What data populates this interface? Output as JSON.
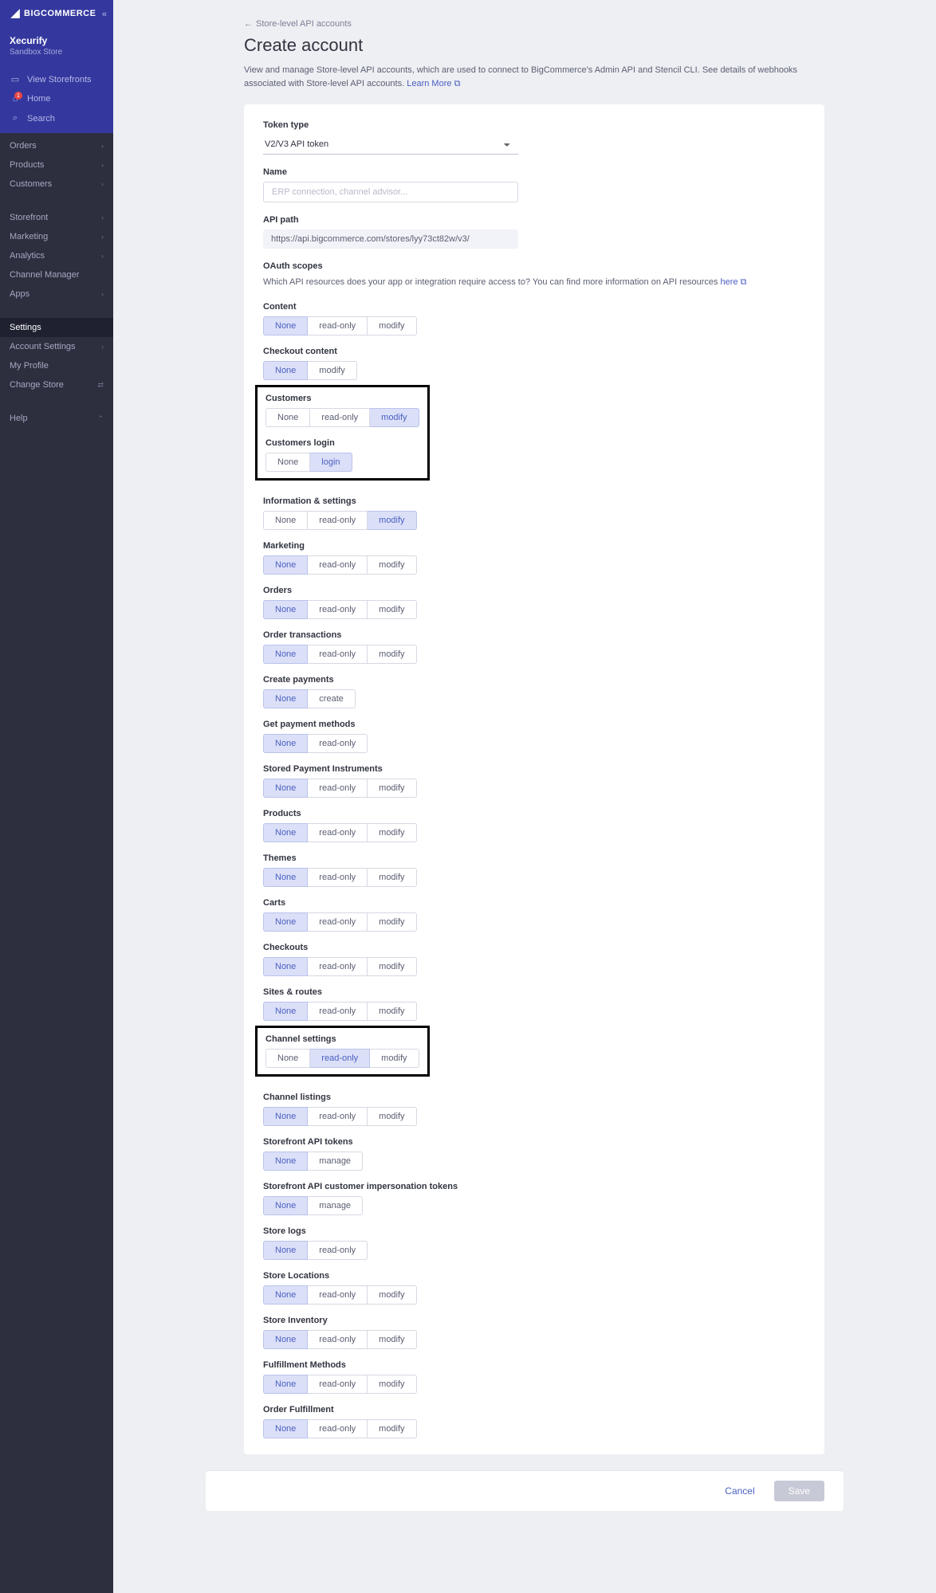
{
  "brand": "BIGCOMMERCE",
  "store": {
    "name": "Xecurify",
    "type": "Sandbox Store"
  },
  "sideLinks": {
    "view": "View Storefronts",
    "home": "Home",
    "home_badge": "1",
    "search": "Search"
  },
  "nav": {
    "orders": "Orders",
    "products": "Products",
    "customers": "Customers",
    "storefront": "Storefront",
    "marketing": "Marketing",
    "analytics": "Analytics",
    "channel": "Channel Manager",
    "apps": "Apps",
    "settings": "Settings",
    "account": "Account Settings",
    "profile": "My Profile",
    "change": "Change Store",
    "help": "Help"
  },
  "breadcrumb": "Store-level API accounts",
  "title": "Create account",
  "description": "View and manage Store-level API accounts, which are used to connect to BigCommerce's Admin API and Stencil CLI. See details of webhooks associated with Store-level API accounts.",
  "learn_more": "Learn More",
  "form": {
    "token_type_label": "Token type",
    "token_type_value": "V2/V3 API token",
    "name_label": "Name",
    "name_placeholder": "ERP connection, channel advisor...",
    "api_path_label": "API path",
    "api_path_value": "https://api.bigcommerce.com/stores/lyy73ct82w/v3/",
    "oauth_label": "OAuth scopes",
    "oauth_desc": "Which API resources does your app or integration require access to? You can find more information on API resources",
    "oauth_here": "here"
  },
  "scopes": [
    {
      "label": "Content",
      "opts": [
        "None",
        "read-only",
        "modify"
      ],
      "sel": 0
    },
    {
      "label": "Checkout content",
      "opts": [
        "None",
        "modify"
      ],
      "sel": 0
    },
    {
      "label": "Customers",
      "opts": [
        "None",
        "read-only",
        "modify"
      ],
      "sel": 2,
      "box": 1
    },
    {
      "label": "Customers login",
      "opts": [
        "None",
        "login"
      ],
      "sel": 1,
      "box": 1
    },
    {
      "label": "Information & settings",
      "opts": [
        "None",
        "read-only",
        "modify"
      ],
      "sel": 2
    },
    {
      "label": "Marketing",
      "opts": [
        "None",
        "read-only",
        "modify"
      ],
      "sel": 0
    },
    {
      "label": "Orders",
      "opts": [
        "None",
        "read-only",
        "modify"
      ],
      "sel": 0
    },
    {
      "label": "Order transactions",
      "opts": [
        "None",
        "read-only",
        "modify"
      ],
      "sel": 0
    },
    {
      "label": "Create payments",
      "opts": [
        "None",
        "create"
      ],
      "sel": 0
    },
    {
      "label": "Get payment methods",
      "opts": [
        "None",
        "read-only"
      ],
      "sel": 0
    },
    {
      "label": "Stored Payment Instruments",
      "opts": [
        "None",
        "read-only",
        "modify"
      ],
      "sel": 0
    },
    {
      "label": "Products",
      "opts": [
        "None",
        "read-only",
        "modify"
      ],
      "sel": 0
    },
    {
      "label": "Themes",
      "opts": [
        "None",
        "read-only",
        "modify"
      ],
      "sel": 0
    },
    {
      "label": "Carts",
      "opts": [
        "None",
        "read-only",
        "modify"
      ],
      "sel": 0
    },
    {
      "label": "Checkouts",
      "opts": [
        "None",
        "read-only",
        "modify"
      ],
      "sel": 0
    },
    {
      "label": "Sites & routes",
      "opts": [
        "None",
        "read-only",
        "modify"
      ],
      "sel": 0
    },
    {
      "label": "Channel settings",
      "opts": [
        "None",
        "read-only",
        "modify"
      ],
      "sel": 1,
      "box": 2
    },
    {
      "label": "Channel listings",
      "opts": [
        "None",
        "read-only",
        "modify"
      ],
      "sel": 0
    },
    {
      "label": "Storefront API tokens",
      "opts": [
        "None",
        "manage"
      ],
      "sel": 0
    },
    {
      "label": "Storefront API customer impersonation tokens",
      "opts": [
        "None",
        "manage"
      ],
      "sel": 0
    },
    {
      "label": "Store logs",
      "opts": [
        "None",
        "read-only"
      ],
      "sel": 0
    },
    {
      "label": "Store Locations",
      "opts": [
        "None",
        "read-only",
        "modify"
      ],
      "sel": 0
    },
    {
      "label": "Store Inventory",
      "opts": [
        "None",
        "read-only",
        "modify"
      ],
      "sel": 0
    },
    {
      "label": "Fulfillment Methods",
      "opts": [
        "None",
        "read-only",
        "modify"
      ],
      "sel": 0
    },
    {
      "label": "Order Fulfillment",
      "opts": [
        "None",
        "read-only",
        "modify"
      ],
      "sel": 0
    }
  ],
  "footer": {
    "cancel": "Cancel",
    "save": "Save"
  }
}
